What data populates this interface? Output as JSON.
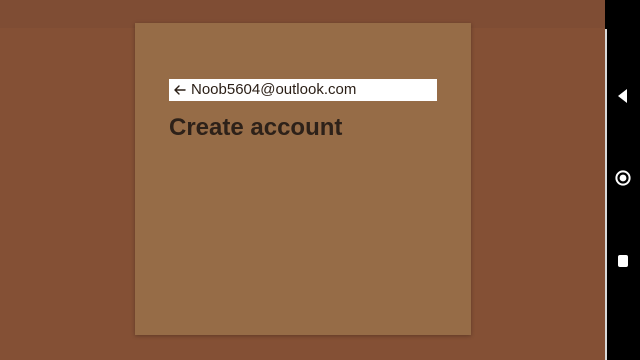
{
  "dialog": {
    "email": "Noob5604@outlook.com",
    "title": "Create account",
    "back_icon": "arrow-left-icon"
  },
  "system_nav": {
    "buttons": [
      {
        "name": "back",
        "icon": "triangle-left-icon"
      },
      {
        "name": "home",
        "icon": "circle-icon"
      },
      {
        "name": "recent",
        "icon": "square-icon"
      }
    ]
  },
  "colors": {
    "background": "#845035",
    "dialog": "#966c47",
    "account_bar": "#ffffff",
    "navbar": "#000000",
    "text": "#2d2119"
  }
}
